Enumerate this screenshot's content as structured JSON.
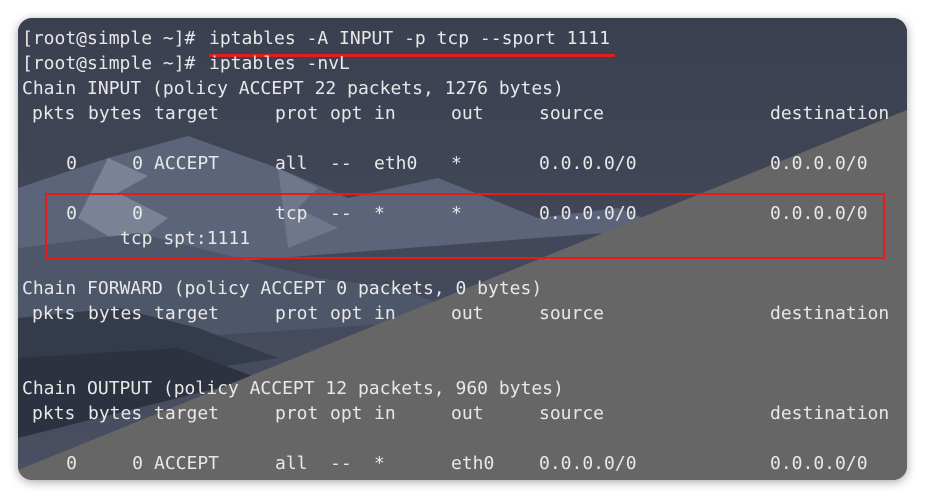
{
  "colors": {
    "text": "#e8e8e8",
    "highlight": "#e41c1c",
    "background_dark": "#404553"
  },
  "command1": {
    "prompt": "[root@simple ~]#",
    "command": "iptables -A INPUT -p tcp --sport 1111"
  },
  "command2": {
    "prompt": "[root@simple ~]#",
    "command": "iptables -nvL"
  },
  "headers": {
    "pkts": "pkts",
    "bytes": "bytes",
    "target": "target",
    "prot": "prot",
    "opt": "opt",
    "in": "in",
    "out": "out",
    "source": "source",
    "destination": "destination"
  },
  "chains": [
    {
      "title": "Chain INPUT (policy ACCEPT 22 packets, 1276 bytes)",
      "rules": [
        {
          "pkts": "0",
          "bytes": "0",
          "target": "ACCEPT",
          "prot": "all",
          "opt": "--",
          "in": "eth0",
          "out": "*",
          "source": "0.0.0.0/0",
          "destination": "0.0.0.0/0"
        },
        {
          "pkts": "0",
          "bytes": "0",
          "target": "",
          "prot": "tcp",
          "opt": "--",
          "in": "*",
          "out": "*",
          "source": "0.0.0.0/0",
          "destination": "0.0.0.0/0",
          "extra": "tcp spt:1111"
        }
      ]
    },
    {
      "title": "Chain FORWARD (policy ACCEPT 0 packets, 0 bytes)",
      "rules": []
    },
    {
      "title": "Chain OUTPUT (policy ACCEPT 12 packets, 960 bytes)",
      "rules": [
        {
          "pkts": "0",
          "bytes": "0",
          "target": "ACCEPT",
          "prot": "all",
          "opt": "--",
          "in": "*",
          "out": "eth0",
          "source": "0.0.0.0/0",
          "destination": "0.0.0.0/0"
        }
      ]
    }
  ]
}
